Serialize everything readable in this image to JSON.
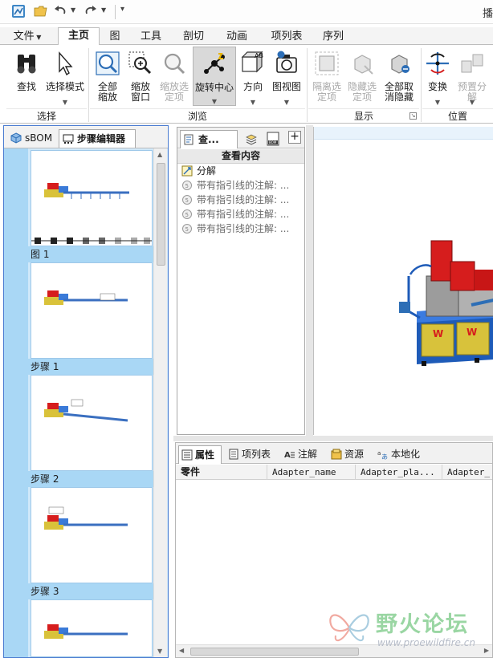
{
  "window": {
    "title_fragment": "播"
  },
  "ribbon_tabs": [
    "文件",
    "主页",
    "图",
    "工具",
    "剖切",
    "动画",
    "项列表",
    "序列"
  ],
  "ribbon": {
    "find": "查找",
    "select_mode": "选择模式",
    "zoom_all": "全部\n缩放",
    "zoom_window": "缩放\n窗口",
    "zoom_selected": "缩放选\n定项",
    "spin_center": "旋转中心",
    "orientation": "方向",
    "view": "图视图",
    "isolate": "隔离选\n定项",
    "hide": "隐藏选\n定项",
    "unhide_all": "全部取\n消隐藏",
    "transform": "变换",
    "preset_explode": "预置分\n解",
    "groups": {
      "select": "选择",
      "browse": "浏览",
      "display": "显示",
      "position": "位置"
    }
  },
  "left_panel": {
    "tabs": [
      "sBOM",
      "步骤编辑器"
    ],
    "items": [
      {
        "label": "图 1"
      },
      {
        "label": "步骤 1"
      },
      {
        "label": "步骤 2"
      },
      {
        "label": "步骤 3"
      }
    ]
  },
  "middle_panel": {
    "tab_label": "查...",
    "header": "查看内容",
    "items": [
      "分解",
      "带有指引线的注解: ...",
      "带有指引线的注解: ...",
      "带有指引线的注解: ...",
      "带有指引线的注解: ..."
    ]
  },
  "bottom_panel": {
    "tabs": [
      "属性",
      "项列表",
      "注解",
      "资源",
      "本地化"
    ],
    "columns": [
      "零件",
      "Adapter_name",
      "Adapter_pla...",
      "Adapter_"
    ]
  },
  "watermark": {
    "text": "野火论坛",
    "url": "www.proewildfire.cn"
  },
  "colors": {
    "accent_blue": "#4a7bd0",
    "strip": "#a9d7f5",
    "machine_red": "#d61d1d",
    "machine_blue": "#1e5bb8"
  }
}
